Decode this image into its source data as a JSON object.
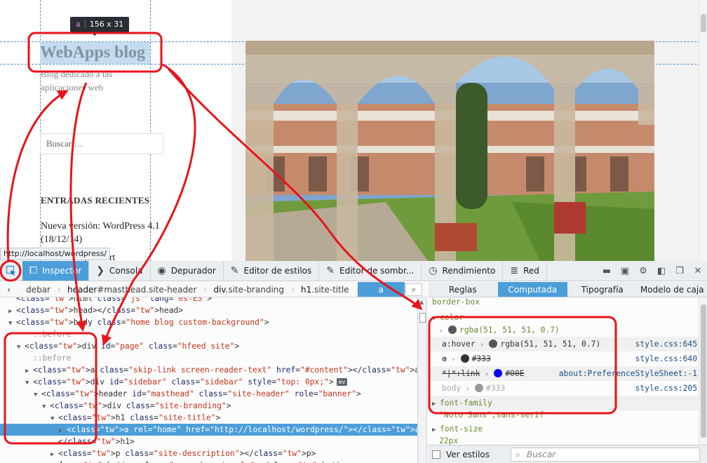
{
  "page": {
    "tooltip": {
      "tag": "a",
      "size": "156 x 31"
    },
    "site_title": "WebApps blog",
    "site_description": "Blog dedicado a las aplicaciones web",
    "search_placeholder": "Buscar …",
    "recent_heading": "ENTRADAS RECIENTES",
    "recent_items": [
      "Nueva versión: WordPress 4.1 (18/12/14)",
      "penCart"
    ],
    "status_url": "http://localhost/wordpress/"
  },
  "toolbar": {
    "tabs": [
      {
        "label": "Inspector",
        "icon": "inspector-icon",
        "selected": true
      },
      {
        "label": "Consola",
        "icon": "console-icon"
      },
      {
        "label": "Depurador",
        "icon": "debugger-icon"
      },
      {
        "label": "Editor de estilos",
        "icon": "style-editor-icon"
      },
      {
        "label": "Editor de sombr...",
        "icon": "shader-editor-icon"
      },
      {
        "label": "Rendimiento",
        "icon": "performance-icon"
      },
      {
        "label": "Red",
        "icon": "network-icon"
      }
    ]
  },
  "breadcrumbs": [
    {
      "text": "debar",
      "tag": ""
    },
    {
      "tag": "header",
      "rest": "#masthead.site-header"
    },
    {
      "tag": "div",
      "rest": ".site-branding"
    },
    {
      "tag": "h1",
      "rest": ".site-title"
    },
    {
      "tag": "a",
      "rest": "",
      "selected": true
    }
  ],
  "markup": [
    {
      "indent": 1,
      "tri": "",
      "text": "<html class=\"js\" lang=\"es-ES\">"
    },
    {
      "indent": 1,
      "tri": "▶",
      "text": "<head></head>"
    },
    {
      "indent": 1,
      "tri": "▼",
      "text": "<body class=\"home blog custom-background\">"
    },
    {
      "indent": 3,
      "tri": "",
      "text": "::before",
      "pseudo": true
    },
    {
      "indent": 2,
      "tri": "▼",
      "text": "<div id=\"page\" class=\"hfeed site\">"
    },
    {
      "indent": 3,
      "tri": "",
      "text": "::before",
      "pseudo": true
    },
    {
      "indent": 3,
      "tri": "▶",
      "text": "<a class=\"skip-link screen-reader-text\" href=\"#content\"></a>"
    },
    {
      "indent": 3,
      "tri": "▼",
      "text": "<div id=\"sidebar\" class=\"sidebar\" style=\"top: 0px;\">",
      "ev": "ev"
    },
    {
      "indent": 4,
      "tri": "▼",
      "text": "<header id=\"masthead\" class=\"site-header\" role=\"banner\">"
    },
    {
      "indent": 5,
      "tri": "▼",
      "text": "<div class=\"site-branding\">"
    },
    {
      "indent": 6,
      "tri": "▼",
      "text": "<h1 class=\"site-title\">"
    },
    {
      "indent": 7,
      "tri": "▶",
      "text": "<a rel=\"home\" href=\"http://localhost/wordpress/\"></a>",
      "selected": true
    },
    {
      "indent": 6,
      "tri": "",
      "text": "</h1>"
    },
    {
      "indent": 6,
      "tri": "▶",
      "text": "<p class=\"site-description\"></p>"
    },
    {
      "indent": 5,
      "tri": "",
      "text": "<button class=\"secondary-toggle\"></button>"
    }
  ],
  "side_tabs": [
    {
      "label": "Reglas"
    },
    {
      "label": "Computada",
      "selected": true
    },
    {
      "label": "Tipografía"
    },
    {
      "label": "Modelo de caja"
    }
  ],
  "computed": {
    "border_box": "border-box",
    "color_prop": "color",
    "color_value": "rgba(51, 51, 51, 0.7)",
    "rules": [
      {
        "selector": "a:hover",
        "value": "rgba(51, 51, 51, 0.7)",
        "swatch": "#555555",
        "source": "style.css:645"
      },
      {
        "selector": "a",
        "value": "#333",
        "swatch": "#333333",
        "source": "style.css:640",
        "strike": true
      },
      {
        "selector": "*|*:link",
        "value": "#00E",
        "swatch": "#0000ee",
        "source": "about:PreferenceStyleSheet:-1",
        "strike": true
      },
      {
        "selector": "body",
        "value": "#333",
        "swatch": "#999999",
        "source": "style.css:205",
        "muted": true
      }
    ],
    "font_family_prop": "font-family",
    "font_family_value": "\"Noto Sans\",sans-serif",
    "font_size_prop": "font-size",
    "font_size_value": "22px"
  },
  "filter": {
    "show_styles_label": "Ver estilos",
    "search_placeholder": "Buscar"
  },
  "colors": {
    "accent": "#4c9ed9",
    "annotation": "#e8141a",
    "tag": "#0b7a8c",
    "attr_value": "#c5321a"
  }
}
